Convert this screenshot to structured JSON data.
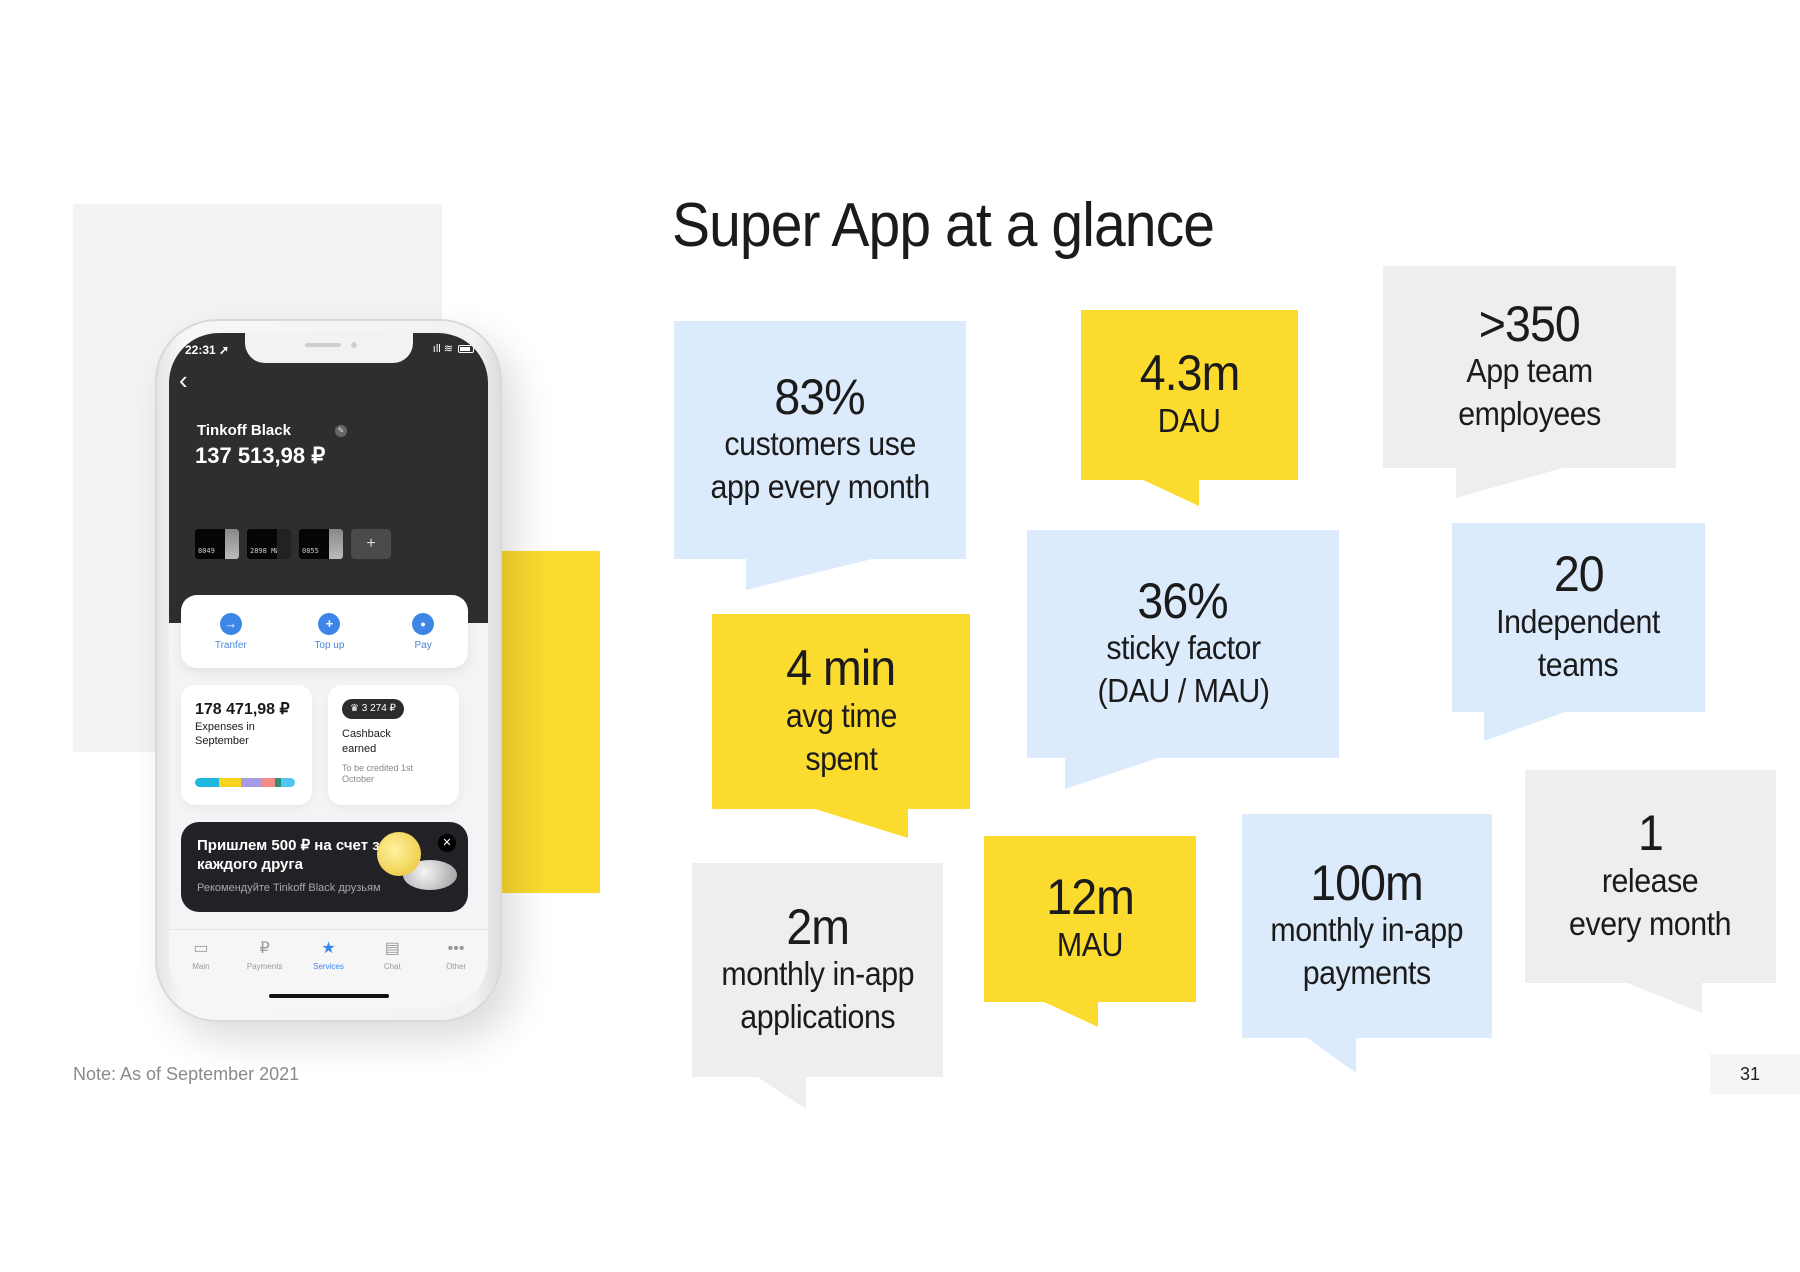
{
  "slide": {
    "title": "Super App at a glance",
    "note": "Note: As of September 2021",
    "page_number": "31",
    "colors": {
      "yellow": "#fbdb2e",
      "blue": "#dcebfb",
      "gray": "#eeeeee",
      "text": "#1b1b1b"
    }
  },
  "phone": {
    "status_time": "22:31 ➚",
    "status_icons": "ıll ≋",
    "back_icon": "‹",
    "account_name": "Tinkoff Black",
    "balance": "137 513,98 ₽",
    "cards": [
      {
        "number": "8049"
      },
      {
        "number": "2898 МИР"
      },
      {
        "number": "0855"
      }
    ],
    "add_card_label": "+",
    "actions": [
      {
        "label": "Tranfer",
        "icon": "→"
      },
      {
        "label": "Top up",
        "icon": "+"
      },
      {
        "label": "Pay",
        "icon": "●"
      }
    ],
    "expenses": {
      "amount": "178 471,98 ₽",
      "label": "Expenses in September",
      "bar_segments": [
        {
          "color": "#1fb6e0",
          "share": 0.24
        },
        {
          "color": "#f7d51f",
          "share": 0.22
        },
        {
          "color": "#a79be8",
          "share": 0.2
        },
        {
          "color": "#f48b86",
          "share": 0.14
        },
        {
          "color": "#2f8f7a",
          "share": 0.06
        },
        {
          "color": "#4fc7f0",
          "share": 0.14
        }
      ]
    },
    "cashback": {
      "pill": "♛ 3 274 ₽",
      "label": "Cashback earned",
      "note": "To be credited 1st October"
    },
    "promo": {
      "title": "Пришлем 500 ₽ на счет за каждого друга",
      "subtitle": "Рекомендуйте Tinkoff Black друзьям",
      "close_icon": "✕"
    },
    "tabs": [
      {
        "label": "Main",
        "icon": "▭",
        "active": false
      },
      {
        "label": "Payments",
        "icon": "₽",
        "active": false
      },
      {
        "label": "Services",
        "icon": "★",
        "active": true
      },
      {
        "label": "Chat",
        "icon": "▤",
        "active": false
      },
      {
        "label": "Other",
        "icon": "•••",
        "active": false
      }
    ]
  },
  "stats": [
    {
      "id": "b-83",
      "value": "83%",
      "desc": "customers use\napp every month",
      "color": "blue"
    },
    {
      "id": "b-43",
      "value": "4.3m",
      "desc": "DAU",
      "color": "yellow"
    },
    {
      "id": "b-350",
      "value": ">350",
      "desc": "App team\nemployees",
      "color": "gray"
    },
    {
      "id": "b-4min",
      "value": "4 min",
      "desc": "avg time\nspent",
      "color": "yellow"
    },
    {
      "id": "b-36",
      "value": "36%",
      "desc": "sticky factor\n(DAU / MAU)",
      "color": "blue"
    },
    {
      "id": "b-20",
      "value": "20",
      "desc": "Independent\nteams",
      "color": "blue"
    },
    {
      "id": "b-2m",
      "value": "2m",
      "desc": "monthly in-app\napplications",
      "color": "gray"
    },
    {
      "id": "b-12m",
      "value": "12m",
      "desc": "MAU",
      "color": "yellow"
    },
    {
      "id": "b-100m",
      "value": "100m",
      "desc": "monthly in-app\npayments",
      "color": "blue"
    },
    {
      "id": "b-1",
      "value": "1",
      "desc": "release\nevery month",
      "color": "gray"
    }
  ]
}
